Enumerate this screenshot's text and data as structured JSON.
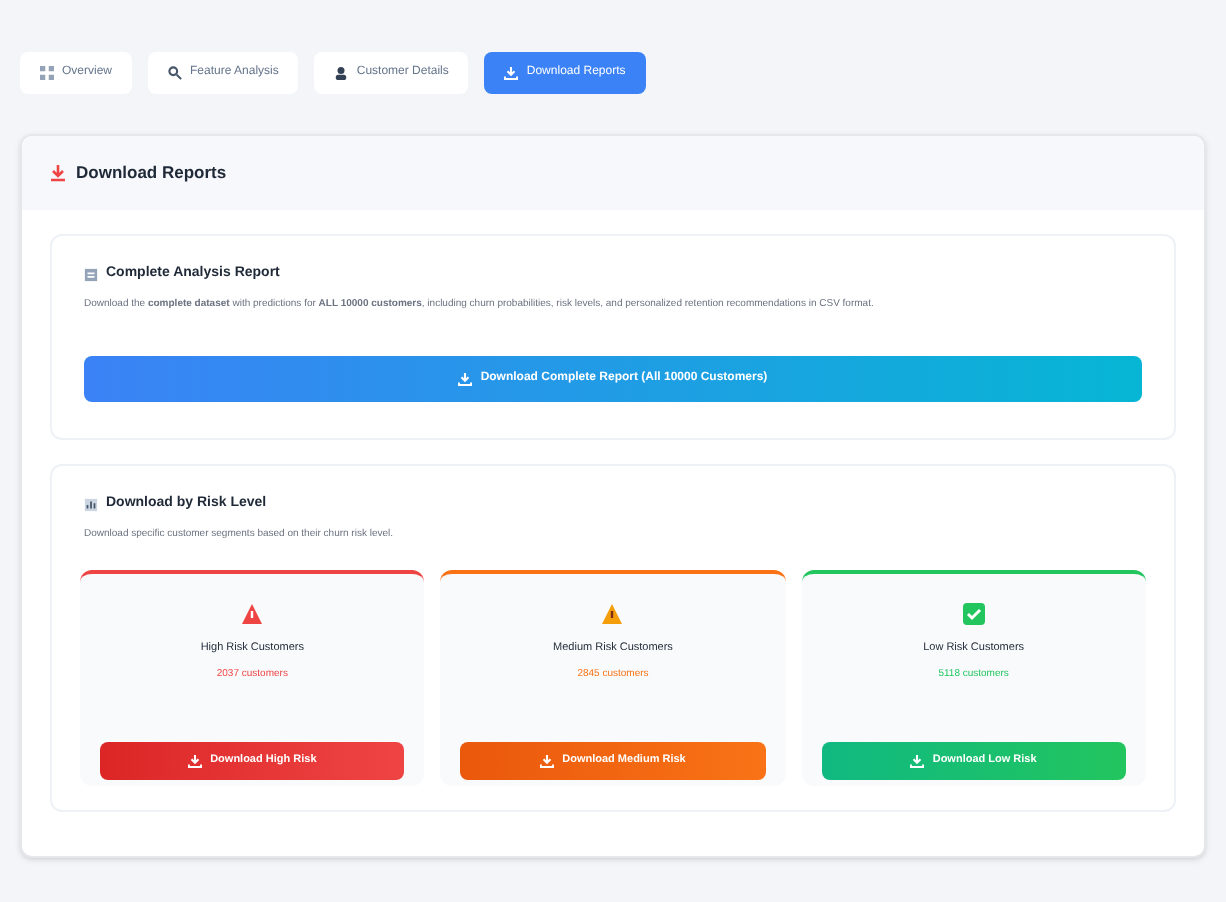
{
  "tabs": [
    {
      "label": "Overview",
      "kind": "grid",
      "selected": false
    },
    {
      "label": "Feature Analysis",
      "kind": "search",
      "selected": false
    },
    {
      "label": "Customer Details",
      "kind": "user",
      "selected": false
    },
    {
      "label": "Download Reports",
      "kind": "download",
      "selected": true
    }
  ],
  "panel": {
    "title": "Download Reports",
    "complete": {
      "title": "Complete Analysis Report",
      "description": "Download the **complete dataset** with predictions for **ALL 10000 customers**, including churn probabilities, risk levels, and personalized retention recommendations in CSV format.",
      "button": "Download Complete Report (All 10000 Customers)"
    },
    "by_risk": {
      "title": "Download by Risk Level",
      "description": "Download specific customer segments based on their churn risk level.",
      "levels": [
        {
          "kind": "high",
          "title": "High Risk Customers",
          "count": "2037 customers",
          "button": "Download High Risk",
          "color": "#ef4444"
        },
        {
          "kind": "medium",
          "title": "Medium Risk Customers",
          "count": "2845 customers",
          "button": "Download Medium Risk",
          "color": "#f97316"
        },
        {
          "kind": "low",
          "title": "Low Risk Customers",
          "count": "5118 customers",
          "button": "Download Low Risk",
          "color": "#22c55e"
        }
      ]
    }
  }
}
